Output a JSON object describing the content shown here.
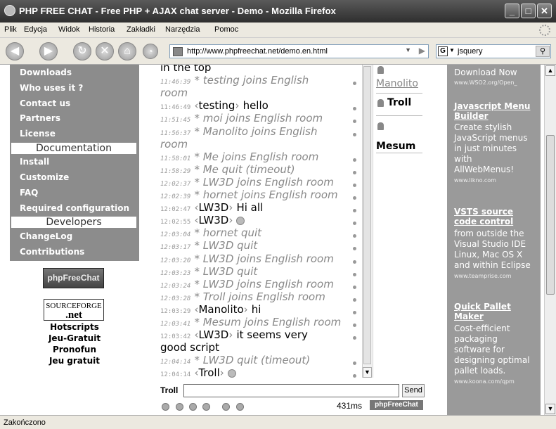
{
  "window": {
    "title": "PHP FREE CHAT - Free PHP + AJAX chat server - Demo - Mozilla Firefox"
  },
  "menu": [
    "Plik",
    "Edycja",
    "Widok",
    "Historia",
    "Zakładki",
    "Narzędzia",
    "Pomoc"
  ],
  "address": {
    "url": "http://www.phpfreechat.net/demo.en.html"
  },
  "search": {
    "value": "jsquery"
  },
  "sidebar": {
    "links_top": [
      "Downloads",
      "Who uses it ?",
      "Contact us",
      "Partners",
      "License"
    ],
    "header_doc": "Documentation",
    "links_doc": [
      "Install",
      "Customize",
      "FAQ",
      "Required configuration"
    ],
    "header_dev": "Developers",
    "links_dev": [
      "ChangeLog",
      "Contributions"
    ],
    "pfc_badge": "phpFreeChat",
    "sf_badge_1": "SOURCEFORGE",
    "sf_badge_2": ".net",
    "bottom_links": [
      "Hotscripts",
      "Jeu-Gratuit",
      "Pronofun",
      "Jeu gratuit"
    ]
  },
  "chat": {
    "lines": [
      {
        "ts": "",
        "nick": "",
        "text": "in the top",
        "kind": "cont"
      },
      {
        "ts": "11:46:39",
        "nick": "",
        "text": "* testing joins English",
        "kind": "notice"
      },
      {
        "ts": "",
        "nick": "",
        "text": "room",
        "kind": "contnotice"
      },
      {
        "ts": "11:46:49",
        "nick": "testing",
        "text": "hello",
        "kind": "msg"
      },
      {
        "ts": "11:51:45",
        "nick": "",
        "text": "* moi joins English room",
        "kind": "notice"
      },
      {
        "ts": "11:56:37",
        "nick": "",
        "text": "* Manolito joins English",
        "kind": "notice"
      },
      {
        "ts": "",
        "nick": "",
        "text": "room",
        "kind": "contnotice"
      },
      {
        "ts": "11:58:01",
        "nick": "",
        "text": "* Me joins English room",
        "kind": "notice"
      },
      {
        "ts": "11:58:29",
        "nick": "",
        "text": "* Me quit (timeout)",
        "kind": "notice"
      },
      {
        "ts": "12:02:37",
        "nick": "",
        "text": "* LW3D joins English room",
        "kind": "notice"
      },
      {
        "ts": "12:02:39",
        "nick": "",
        "text": "* hornet joins English room",
        "kind": "notice"
      },
      {
        "ts": "12:02:47",
        "nick": "LW3D",
        "text": "Hi all",
        "kind": "msg"
      },
      {
        "ts": "12:02:55",
        "nick": "LW3D",
        "text": "",
        "kind": "msgemot"
      },
      {
        "ts": "12:03:04",
        "nick": "",
        "text": "* hornet quit",
        "kind": "notice"
      },
      {
        "ts": "12:03:17",
        "nick": "",
        "text": "* LW3D quit",
        "kind": "notice"
      },
      {
        "ts": "12:03:20",
        "nick": "",
        "text": "* LW3D joins English room",
        "kind": "notice"
      },
      {
        "ts": "12:03:23",
        "nick": "",
        "text": "* LW3D quit",
        "kind": "notice"
      },
      {
        "ts": "12:03:24",
        "nick": "",
        "text": "* LW3D joins English room",
        "kind": "notice"
      },
      {
        "ts": "12:03:28",
        "nick": "",
        "text": "* Troll joins English room",
        "kind": "notice"
      },
      {
        "ts": "12:03:29",
        "nick": "Manolito",
        "text": "hi",
        "kind": "msg"
      },
      {
        "ts": "12:03:41",
        "nick": "",
        "text": "* Mesum joins English room",
        "kind": "notice"
      },
      {
        "ts": "12:03:42",
        "nick": "LW3D",
        "text": "it seems very",
        "kind": "msg"
      },
      {
        "ts": "",
        "nick": "",
        "text": "good script",
        "kind": "contmsg"
      },
      {
        "ts": "12:04:14",
        "nick": "",
        "text": "* LW3D quit (timeout)",
        "kind": "notice"
      },
      {
        "ts": "12:04:14",
        "nick": "Troll",
        "text": "",
        "kind": "msgemot"
      }
    ]
  },
  "users": [
    "Manolito",
    "Troll",
    "Mesum"
  ],
  "input": {
    "nick": "Troll",
    "value": "",
    "send_label": "Send"
  },
  "footer": {
    "ping": "431ms",
    "badge": "phpFreeChat"
  },
  "ads": [
    {
      "title": "",
      "desc": [
        "Download Now"
      ],
      "url": "www.WSO2.org/Open_"
    },
    {
      "title": "Javascript Menu Builder",
      "desc": [
        "Create stylish",
        "JavaScript menus",
        "in just minutes",
        "with",
        "AllWebMenus!"
      ],
      "url": "www.likno.com"
    },
    {
      "title": "VSTS source code control",
      "desc": [
        "from outside the",
        "Visual Studio IDE",
        "Linux, Mac OS X",
        "and within Eclipse"
      ],
      "url": "www.teamprise.com"
    },
    {
      "title": "Quick Pallet Maker",
      "desc": [
        "Cost-efficient",
        "packaging",
        "software for",
        "designing optimal",
        "pallet loads."
      ],
      "url": "www.koona.com/qpm"
    }
  ],
  "status": {
    "text": "Zakończono"
  }
}
